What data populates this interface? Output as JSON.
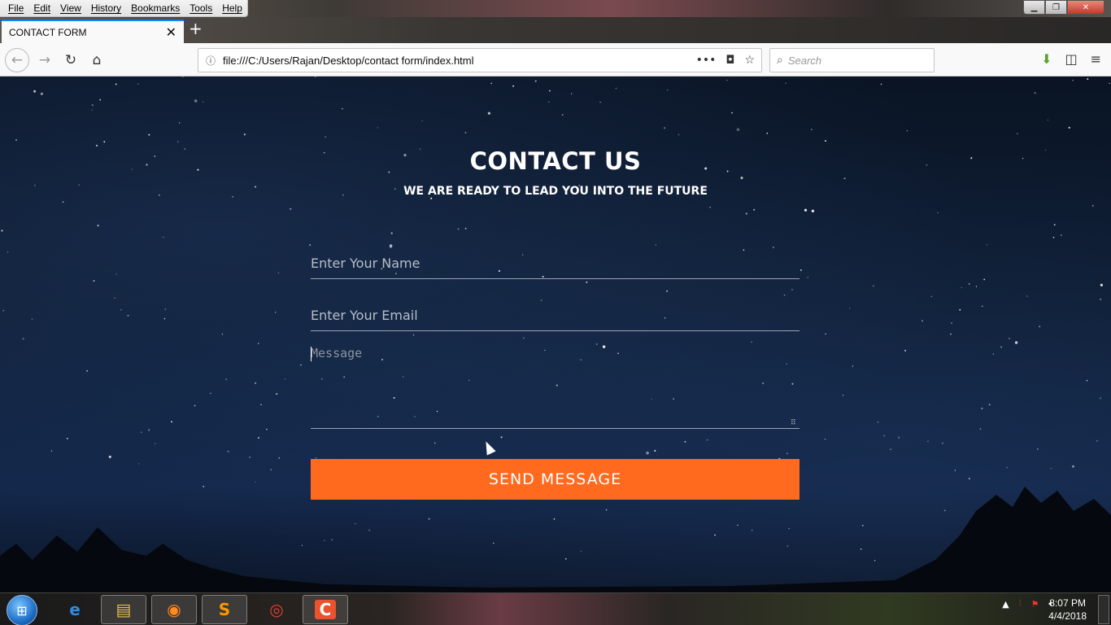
{
  "menu": [
    "File",
    "Edit",
    "View",
    "History",
    "Bookmarks",
    "Tools",
    "Help"
  ],
  "tab": {
    "title": "CONTACT FORM",
    "close": "✕",
    "new_tab": "+"
  },
  "nav": {
    "url": "file:///C:/Users/Rajan/Desktop/contact form/index.html",
    "search_placeholder": "Search"
  },
  "page": {
    "title": "CONTACT US",
    "subtitle": "WE ARE READY TO LEAD YOU INTO THE FUTURE",
    "name_placeholder": "Enter Your Name",
    "email_placeholder": "Enter Your Email",
    "message_placeholder": "Message",
    "send_label": "SEND MESSAGE"
  },
  "colors": {
    "accent": "#ff6a1f",
    "tab_highlight": "#0a84ff"
  },
  "taskbar": {
    "time": "8:07 PM",
    "date": "4/4/2018",
    "apps": [
      "internet-explorer-icon",
      "file-explorer-icon",
      "firefox-icon",
      "sublime-text-icon",
      "chrome-icon",
      "camtasia-icon"
    ]
  }
}
